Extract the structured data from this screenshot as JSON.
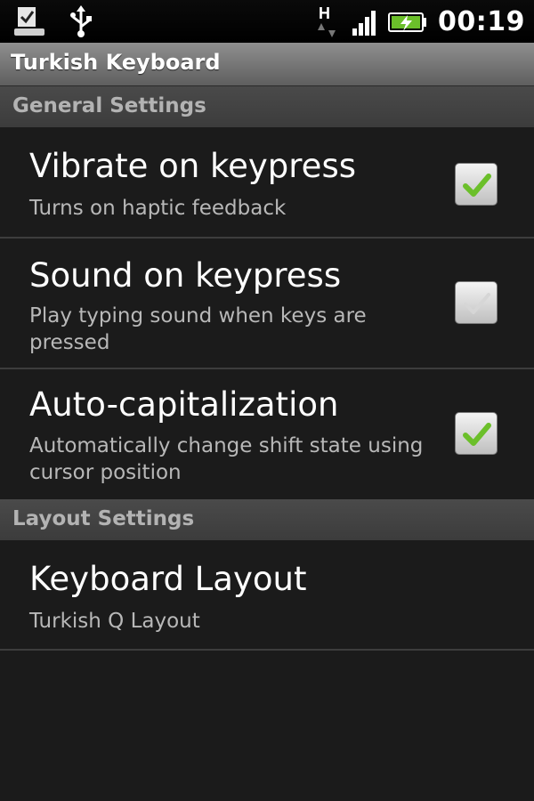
{
  "status_bar": {
    "time": "00:19",
    "icons": [
      "download-done-icon",
      "usb-icon",
      "h-data-icon",
      "signal-icon",
      "battery-charging-icon"
    ],
    "h_indicator": "H"
  },
  "app": {
    "title": "Turkish Keyboard"
  },
  "sections": [
    {
      "header": "General Settings",
      "items": [
        {
          "title": "Vibrate on keypress",
          "summary": "Turns on haptic feedback",
          "checked": true
        },
        {
          "title": "Sound on keypress",
          "summary": "Play typing sound when keys are pressed",
          "checked": false
        },
        {
          "title": "Auto-capitalization",
          "summary": "Automatically change shift state using cursor position",
          "checked": true
        }
      ]
    },
    {
      "header": "Layout Settings",
      "items": [
        {
          "title": "Keyboard Layout",
          "summary": "Turkish Q Layout"
        }
      ]
    }
  ],
  "colors": {
    "check_green": "#6bbf2a",
    "background": "#1b1b1b",
    "section_header": "#444444"
  }
}
